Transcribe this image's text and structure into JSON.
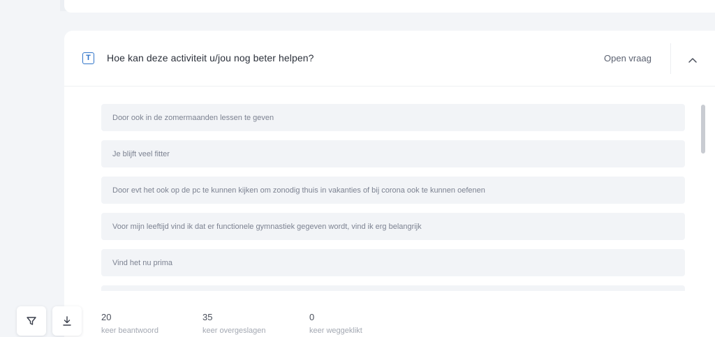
{
  "question": {
    "icon": "text-icon",
    "icon_glyph": "T",
    "title": "Hoe kan deze activiteit u/jou nog beter helpen?",
    "type": "Open vraag"
  },
  "answers": [
    "Door ook in de zomermaanden lessen te geven",
    "Je blijft veel fitter",
    "Door evt het ook op de pc te kunnen kijken om zonodig thuis in vakanties of bij corona ook te kunnen oefenen",
    "Voor mijn leeftijd vind ik dat er functionele gymnastiek gegeven wordt, vind ik erg belangrijk",
    "Vind het nu prima",
    ""
  ],
  "stats": {
    "answered": {
      "value": "20",
      "label": "keer beantwoord"
    },
    "skipped": {
      "value": "35",
      "label": "keer overgeslagen"
    },
    "dismissed": {
      "value": "0",
      "label": "keer weggeklikt"
    }
  },
  "toolbar": {
    "filter_icon": "filter-icon",
    "download_icon": "download-icon"
  },
  "colors": {
    "accent": "#2e73c9",
    "background": "#f3f5f8",
    "answer_bg": "#f2f4f7"
  }
}
